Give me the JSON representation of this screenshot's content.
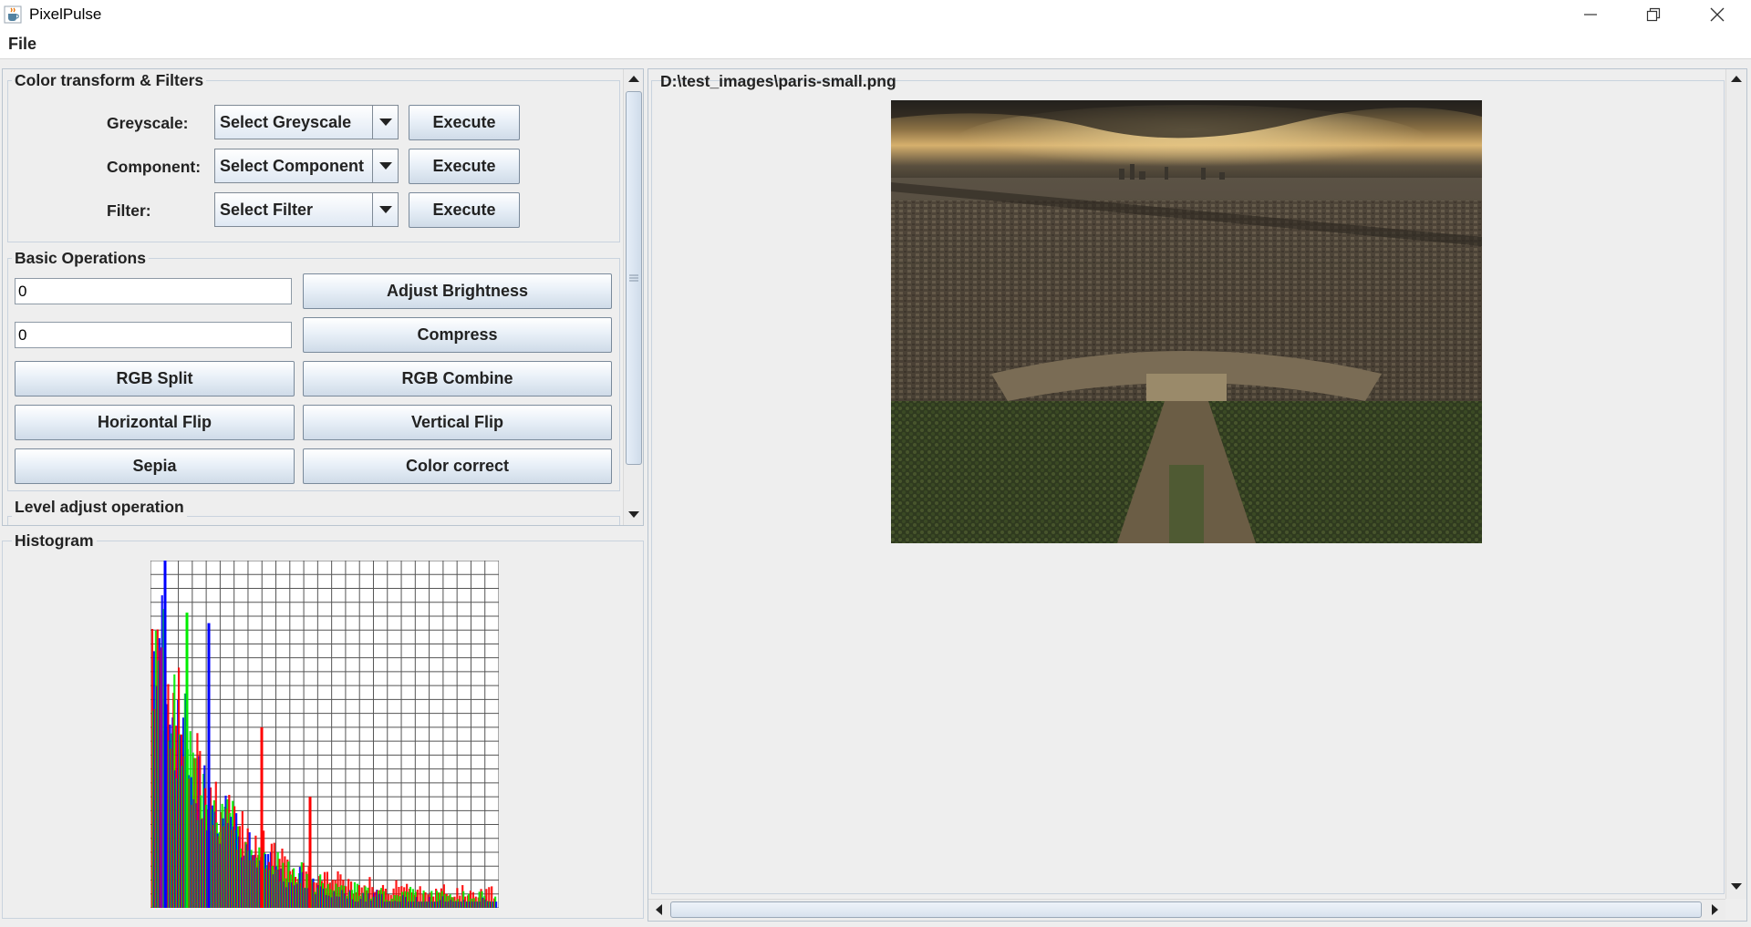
{
  "window": {
    "title": "PixelPulse",
    "app_icon": "java-cup-icon",
    "controls": [
      "minimize-icon",
      "restore-icon",
      "close-icon"
    ]
  },
  "menu": {
    "file": "File"
  },
  "left_panel": {
    "color_group": {
      "title": "Color transform & Filters",
      "rows": [
        {
          "label": "Greyscale:",
          "combo": "Select Greyscale",
          "button": "Execute"
        },
        {
          "label": "Component:",
          "combo": "Select Component",
          "button": "Execute"
        },
        {
          "label": "Filter:",
          "combo": "Select Filter",
          "button": "Execute"
        }
      ]
    },
    "basic_group": {
      "title": "Basic Operations",
      "brightness_value": "0",
      "adjust_brightness": "Adjust Brightness",
      "compress_value": "0",
      "compress": "Compress",
      "rgb_split": "RGB Split",
      "rgb_combine": "RGB Combine",
      "horizontal_flip": "Horizontal Flip",
      "vertical_flip": "Vertical Flip",
      "sepia": "Sepia",
      "color_correct": "Color correct"
    },
    "level_group": {
      "title": "Level adjust operation"
    },
    "histogram": {
      "title": "Histogram",
      "series_colors": {
        "red": "#ff0000",
        "green": "#00ee00",
        "blue": "#0000ff",
        "overlap": "#8800aa"
      },
      "grid_color": "#555555",
      "grid_columns": 25,
      "grid_rows": 25
    }
  },
  "right_panel": {
    "file_path": "D:\\test_images\\paris-small.png"
  },
  "colors": {
    "background": "#eeeeee",
    "button_gradient_top": "#ffffff",
    "button_gradient_bottom": "#cfdbe8",
    "border": "#c9d3de"
  }
}
